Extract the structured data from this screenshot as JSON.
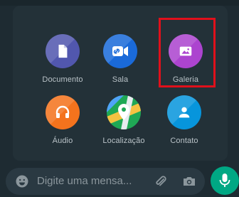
{
  "attachments": [
    {
      "label": "Documento",
      "icon": "document-icon",
      "color": "#5157ae"
    },
    {
      "label": "Sala",
      "icon": "video-link-icon",
      "color": "#1a6ad9"
    },
    {
      "label": "Galeria",
      "icon": "image-icon",
      "color": "#ac44cf"
    },
    {
      "label": "Áudio",
      "icon": "headphones-icon",
      "color": "#f4731d"
    },
    {
      "label": "Localização",
      "icon": "location-pin-icon",
      "color": "#1fa855"
    },
    {
      "label": "Contato",
      "icon": "contact-icon",
      "color": "#0795dc"
    }
  ],
  "composer": {
    "placeholder": "Digite uma mensa..."
  },
  "colors": {
    "highlight": "#e0101b",
    "accent": "#00a884"
  }
}
